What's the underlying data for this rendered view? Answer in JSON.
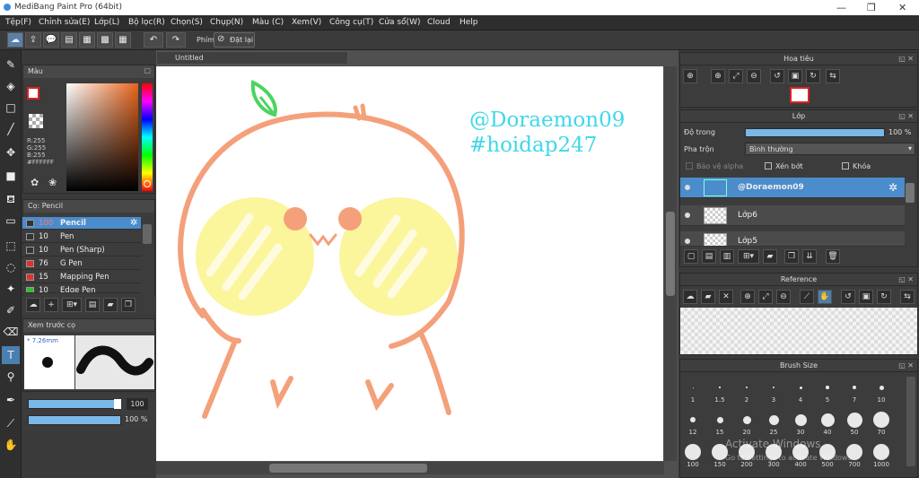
{
  "window": {
    "title": "MediBang Paint Pro (64bit)",
    "min": "—",
    "max": "❐",
    "close": "✕"
  },
  "menu": [
    "Tệp(F)",
    "Chỉnh sửa(E)",
    "Lớp(L)",
    "Bộ lọc(R)",
    "Chọn(S)",
    "Chụp(N)",
    "Màu (C)",
    "Xem(V)",
    "Công cụ(T)",
    "Cửa sổ(W)",
    "Cloud",
    "Help"
  ],
  "toolbar": {
    "key_label": "Phím",
    "reset_label": "Đặt lại"
  },
  "canvas": {
    "tab": "Untitled",
    "text_line1": "@Doraemon09",
    "text_line2": "#hoidap247"
  },
  "color_panel": {
    "title": "Màu",
    "r": "R:255",
    "g": "G:255",
    "b": "B:255",
    "hex": "#FFFFFF"
  },
  "brush_panel": {
    "title": "Cọ: Pencil",
    "items": [
      {
        "size": "100",
        "name": "Pencil",
        "color": "#333333"
      },
      {
        "size": "10",
        "name": "Pen",
        "color": "#333333"
      },
      {
        "size": "10",
        "name": "Pen (Sharp)",
        "color": "#333333"
      },
      {
        "size": "76",
        "name": "G Pen",
        "color": "#e03030"
      },
      {
        "size": "15",
        "name": "Mapping Pen",
        "color": "#e03030"
      },
      {
        "size": "10",
        "name": "Edge Pen",
        "color": "#30c030"
      }
    ]
  },
  "preview_panel": {
    "title": "Xem trước cọ",
    "size": "7.26mm"
  },
  "sliders": {
    "size_value": "100",
    "opacity_value": "100 %"
  },
  "navigator": {
    "title": "Hoa tiêu"
  },
  "layer_panel": {
    "title": "Lớp",
    "opacity_label": "Độ trong",
    "opacity_value": "100 %",
    "blend_label": "Pha trộn",
    "blend_value": "Bình thường",
    "protect_alpha": "Bảo vệ alpha",
    "clipping": "Xén bớt",
    "lock": "Khóa",
    "layers": [
      "@Doraemon09",
      "Lớp6",
      "Lớp5"
    ]
  },
  "reference_panel": {
    "title": "Reference"
  },
  "brush_size_panel": {
    "title": "Brush Size",
    "sizes": [
      "1",
      "1.5",
      "2",
      "3",
      "4",
      "5",
      "7",
      "10",
      "12",
      "15",
      "20",
      "25",
      "30",
      "40",
      "50",
      "70",
      "100",
      "150",
      "200",
      "300",
      "400",
      "500",
      "700",
      "1000"
    ]
  },
  "watermark": {
    "line1": "Activate Windows",
    "line2": "Go to Settings to activate Windows."
  },
  "colors": {
    "accent": "#5aa0d8",
    "selected_row": "#4a8ccc",
    "canvas_text": "#3fd8e8",
    "peach": "#f4a07a",
    "yellow": "#fbf59c",
    "leaf": "#4ad460"
  }
}
